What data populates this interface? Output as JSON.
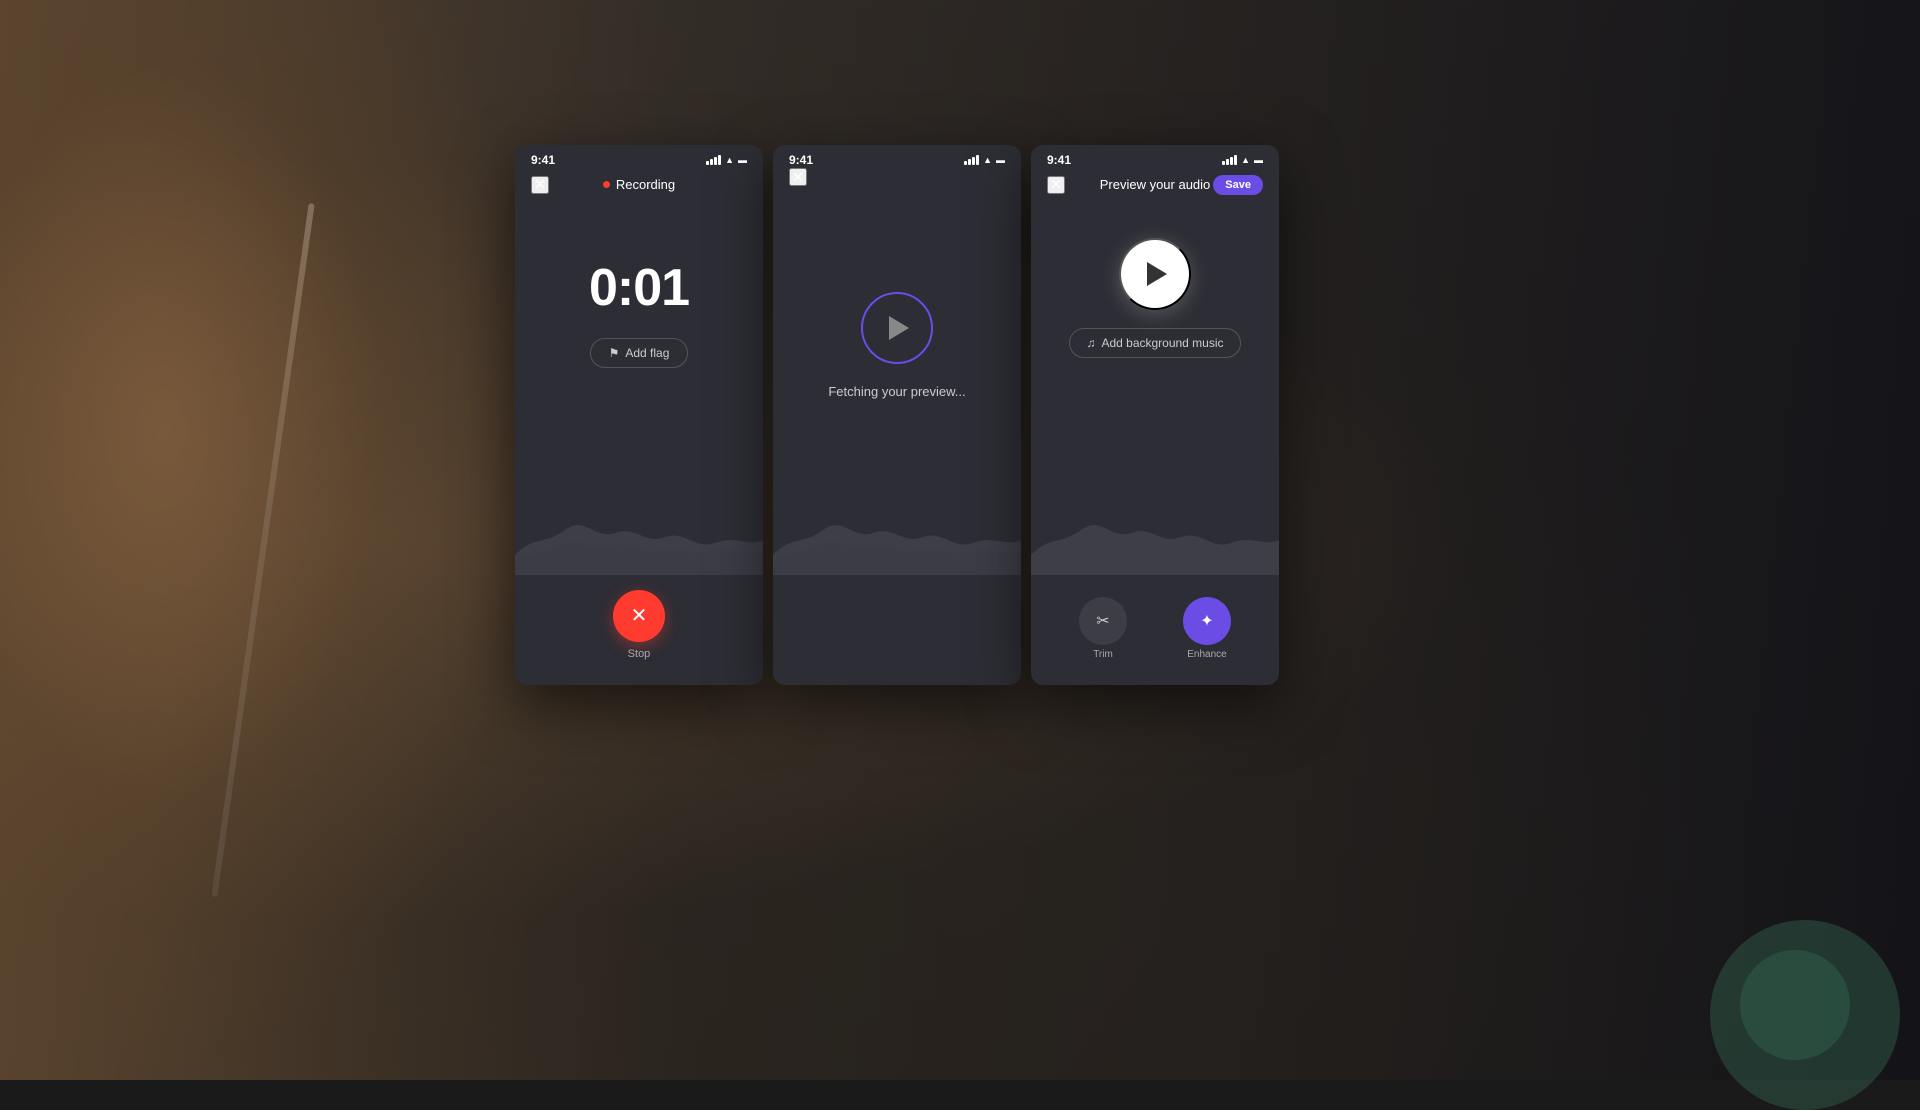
{
  "background": {
    "color": "#1a1a1a"
  },
  "phone1": {
    "status_time": "9:41",
    "nav_title": "Recording",
    "timer": "0:01",
    "add_flag_label": "Add flag",
    "stop_label": "Stop",
    "recording_dot_color": "#ff3b30"
  },
  "phone2": {
    "status_time": "9:41",
    "fetching_text": "Fetching your preview..."
  },
  "phone3": {
    "status_time": "9:41",
    "nav_title": "Preview your audio",
    "save_label": "Save",
    "add_music_label": "Add background music",
    "trim_label": "Trim",
    "enhance_label": "Enhance"
  },
  "icons": {
    "close": "✕",
    "flag": "⚑",
    "music_note": "♫",
    "scissors": "✂",
    "sparkle": "✦"
  }
}
